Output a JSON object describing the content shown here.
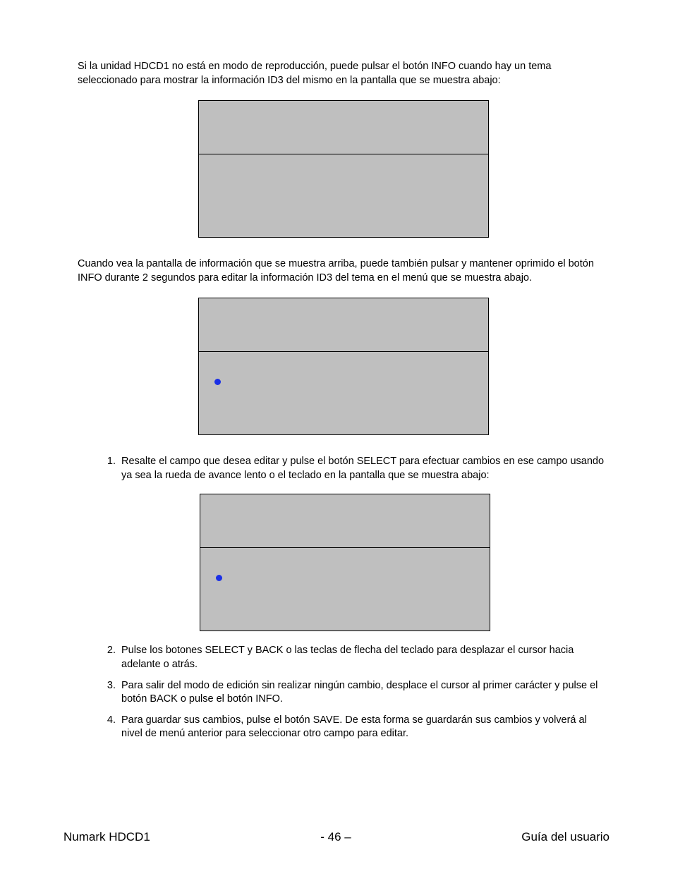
{
  "paragraphs": {
    "p1": "Si la unidad HDCD1 no está en modo de reproducción, puede pulsar el botón INFO cuando hay un tema seleccionado para mostrar la información ID3 del mismo en la pantalla que se muestra abajo:",
    "p2": "Cuando vea la pantalla de información que se muestra arriba, puede también pulsar y mantener oprimido el botón INFO durante 2 segundos para editar la información ID3 del tema en el menú que se muestra abajo."
  },
  "steps": {
    "s1": "Resalte el campo que desea editar y pulse el botón SELECT para efectuar cambios en ese campo usando ya sea la rueda de avance lento o el teclado en la pantalla que se muestra abajo:",
    "s2": "Pulse los botones SELECT y BACK o las teclas de flecha del teclado para desplazar el cursor hacia adelante o atrás.",
    "s3": "Para salir del modo de edición sin realizar ningún cambio, desplace el cursor al primer carácter y pulse el botón BACK o pulse el botón INFO.",
    "s4": "Para guardar sus cambios, pulse el botón SAVE.  De esta forma se guardarán sus cambios y volverá al nivel de menú anterior para seleccionar otro campo para editar."
  },
  "footer": {
    "left": "Numark HDCD1",
    "center": "- 46 –",
    "right": "Guía del usuario"
  }
}
